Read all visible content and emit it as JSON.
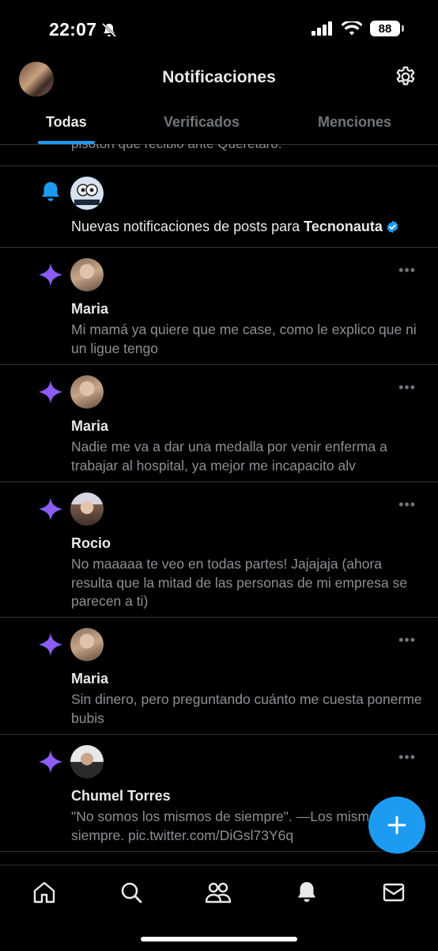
{
  "status": {
    "time": "22:07",
    "battery": "88"
  },
  "header": {
    "title": "Notificaciones"
  },
  "tabs": [
    {
      "label": "Todas",
      "active": true
    },
    {
      "label": "Verificados",
      "active": false
    },
    {
      "label": "Menciones",
      "active": false
    }
  ],
  "feed": {
    "clipped_text": "pisotón que recibió ante Querétaro.",
    "subscription": {
      "text": "Nuevas notificaciones de posts para ",
      "account": "Tecnonauta",
      "avatar_text": "TECNONAUTA"
    },
    "items": [
      {
        "author": "Maria",
        "text": "Mi mamá ya quiere que me case, como le explico que ni un ligue tengo"
      },
      {
        "author": "Maria",
        "text": "Nadie me va a dar una medalla por venir enferma a trabajar al hospital, ya mejor me incapacito alv"
      },
      {
        "author": "Rocio",
        "text": "No maaaaa te veo en todas partes! Jajajaja (ahora resulta que la mitad de las personas de mi empresa se parecen a ti)"
      },
      {
        "author": "Maria",
        "text": "Sin dinero, pero preguntando cuánto me cuesta ponerme bubis"
      },
      {
        "author": "Chumel Torres",
        "text": "\"No somos los mismos de siempre\". —Los mismos de siempre. pic.twitter.com/DiGsl73Y6q"
      }
    ]
  },
  "colors": {
    "accent": "#1d9bf0",
    "sparkle": "#8b5cf6",
    "background": "#000000",
    "secondary_text": "#71767b"
  }
}
